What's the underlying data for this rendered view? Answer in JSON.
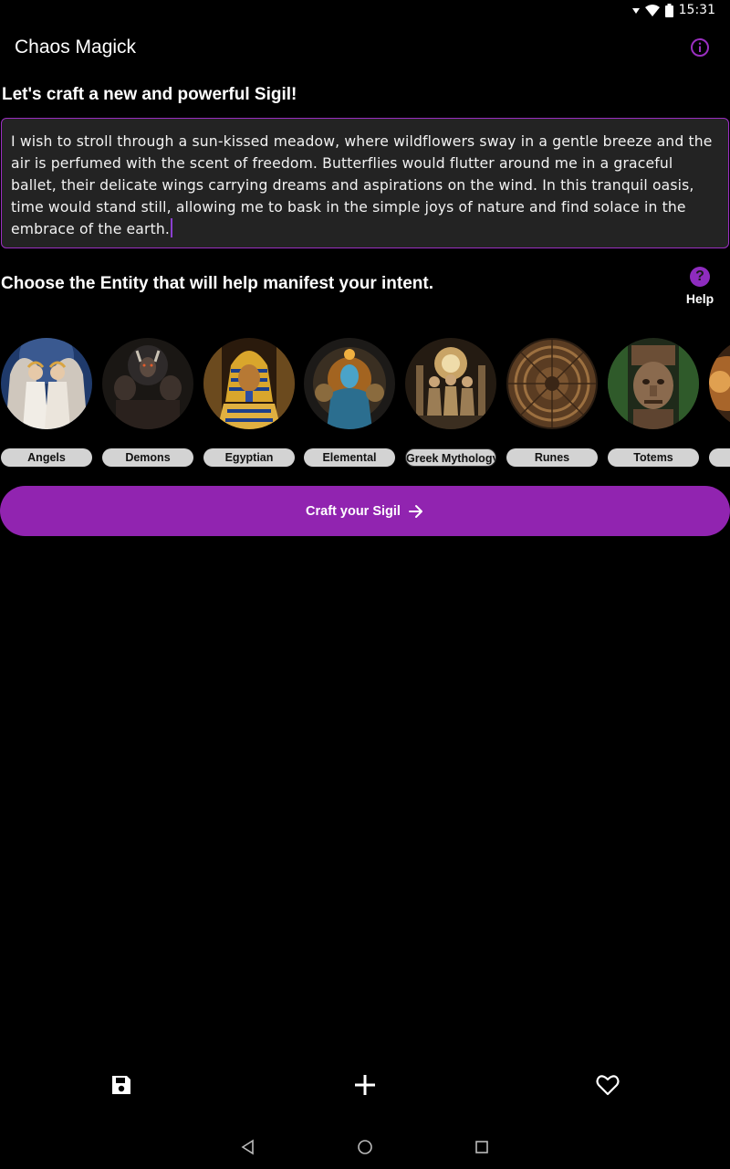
{
  "status_bar": {
    "time": "15:31"
  },
  "app": {
    "title": "Chaos Magick",
    "info_icon": "info-icon"
  },
  "intent": {
    "heading": "Let's craft a new and powerful Sigil!",
    "text": "I wish to stroll through a sun-kissed meadow, where wildflowers sway in a gentle breeze and the air is perfumed with the scent of freedom. Butterflies would flutter around me in a graceful ballet, their delicate wings carrying dreams and aspirations on the wind. In this tranquil oasis, time would stand still, allowing me to bask in the simple joys of nature and find solace in the embrace of the earth."
  },
  "entity_section": {
    "heading": "Choose the Entity that will help manifest your intent.",
    "help_label": "Help",
    "help_glyph": "?"
  },
  "entities": [
    {
      "label": "Angels",
      "selected": false
    },
    {
      "label": "Demons",
      "selected": false
    },
    {
      "label": "Egyptian",
      "selected": false
    },
    {
      "label": "Elemental",
      "selected": false
    },
    {
      "label": "Greek Mythology",
      "selected": true
    },
    {
      "label": "Runes",
      "selected": false
    },
    {
      "label": "Totems",
      "selected": false
    },
    {
      "label": "",
      "selected": false
    }
  ],
  "craft_button": {
    "label": "Craft your Sigil"
  },
  "bottom_nav": {
    "items": [
      "save-icon",
      "add-icon",
      "heart-icon"
    ]
  },
  "colors": {
    "accent": "#9124b0",
    "chip": "#d3d3d3",
    "input_bg": "#232323"
  }
}
